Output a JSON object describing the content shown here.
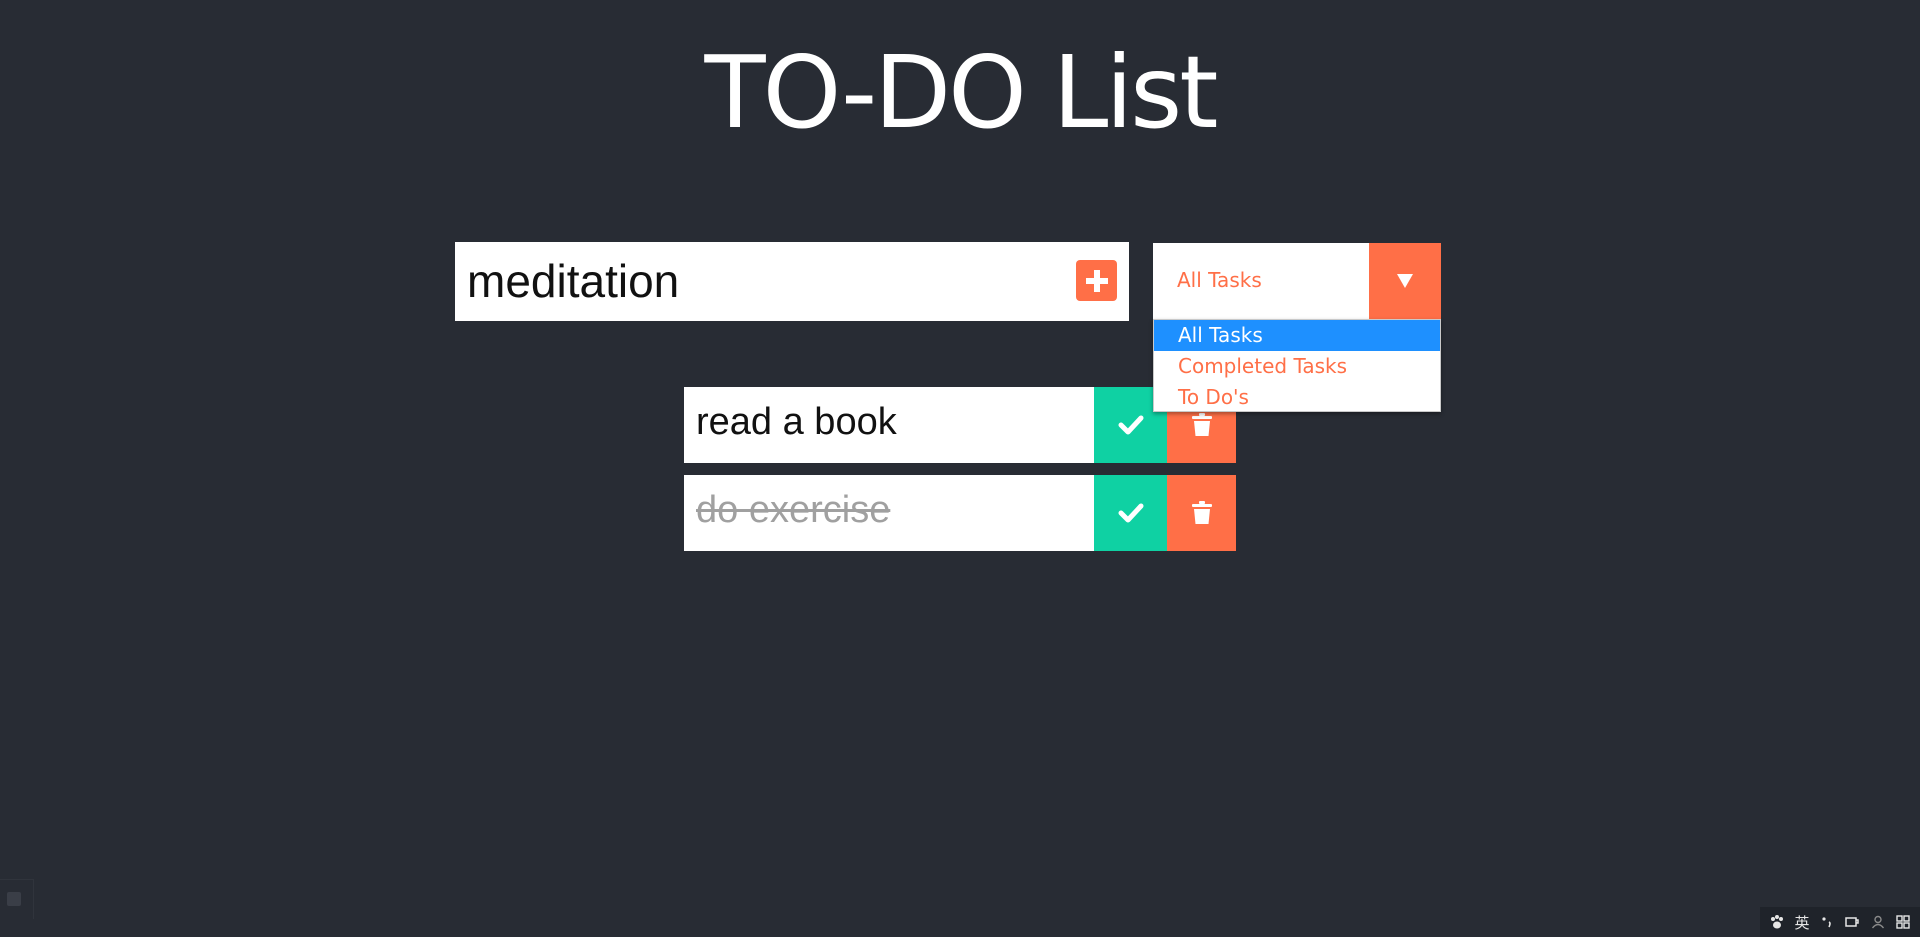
{
  "header": {
    "title": "TO-DO List"
  },
  "task_input": {
    "value": "meditation",
    "add_icon": "plus-icon"
  },
  "filter": {
    "selected": "All Tasks",
    "options": [
      "All Tasks",
      "Completed Tasks",
      "To Do's"
    ]
  },
  "todos": [
    {
      "text": "read a book",
      "completed": false
    },
    {
      "text": "do exercise",
      "completed": true
    }
  ],
  "tray": {
    "ime_label": "英"
  },
  "colors": {
    "background": "#282c34",
    "accent": "#ff6f47",
    "check": "#0fd1a3",
    "selected_option": "#1e90ff"
  }
}
